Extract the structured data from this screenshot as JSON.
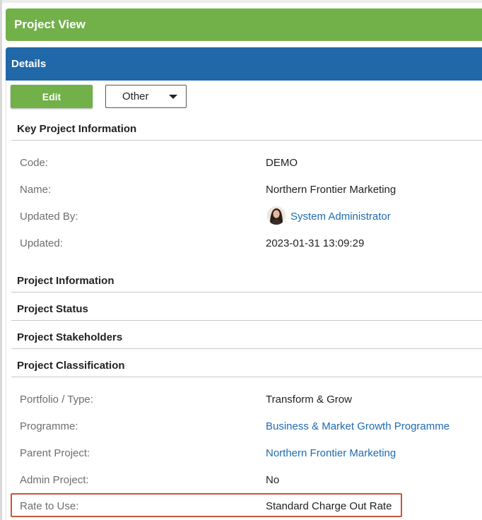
{
  "header": {
    "title": "Project View"
  },
  "details": {
    "title": "Details"
  },
  "toolbar": {
    "edit_label": "Edit",
    "other_label": "Other"
  },
  "key_info": {
    "title": "Key Project Information",
    "code": {
      "label": "Code:",
      "value": "DEMO"
    },
    "name": {
      "label": "Name:",
      "value": "Northern Frontier Marketing"
    },
    "updated_by": {
      "label": "Updated By:",
      "value": "System Administrator"
    },
    "updated": {
      "label": "Updated:",
      "value": "2023-01-31 13:09:29"
    }
  },
  "sections": {
    "project_information": "Project Information",
    "project_status": "Project Status",
    "project_stakeholders": "Project Stakeholders",
    "project_classification": "Project Classification"
  },
  "classification": {
    "portfolio_type": {
      "label": "Portfolio / Type:",
      "value": "Transform & Grow"
    },
    "programme": {
      "label": "Programme:",
      "value": "Business & Market Growth Programme"
    },
    "parent_project": {
      "label": "Parent Project:",
      "value": "Northern Frontier Marketing"
    },
    "admin_project": {
      "label": "Admin Project:",
      "value": "No"
    },
    "rate_to_use": {
      "label": "Rate to Use:",
      "value": "Standard Charge Out Rate"
    }
  },
  "colors": {
    "header_green": "#72b04a",
    "details_blue": "#2068a8",
    "link_blue": "#1f6bb0",
    "highlight_red": "#c8563b"
  }
}
